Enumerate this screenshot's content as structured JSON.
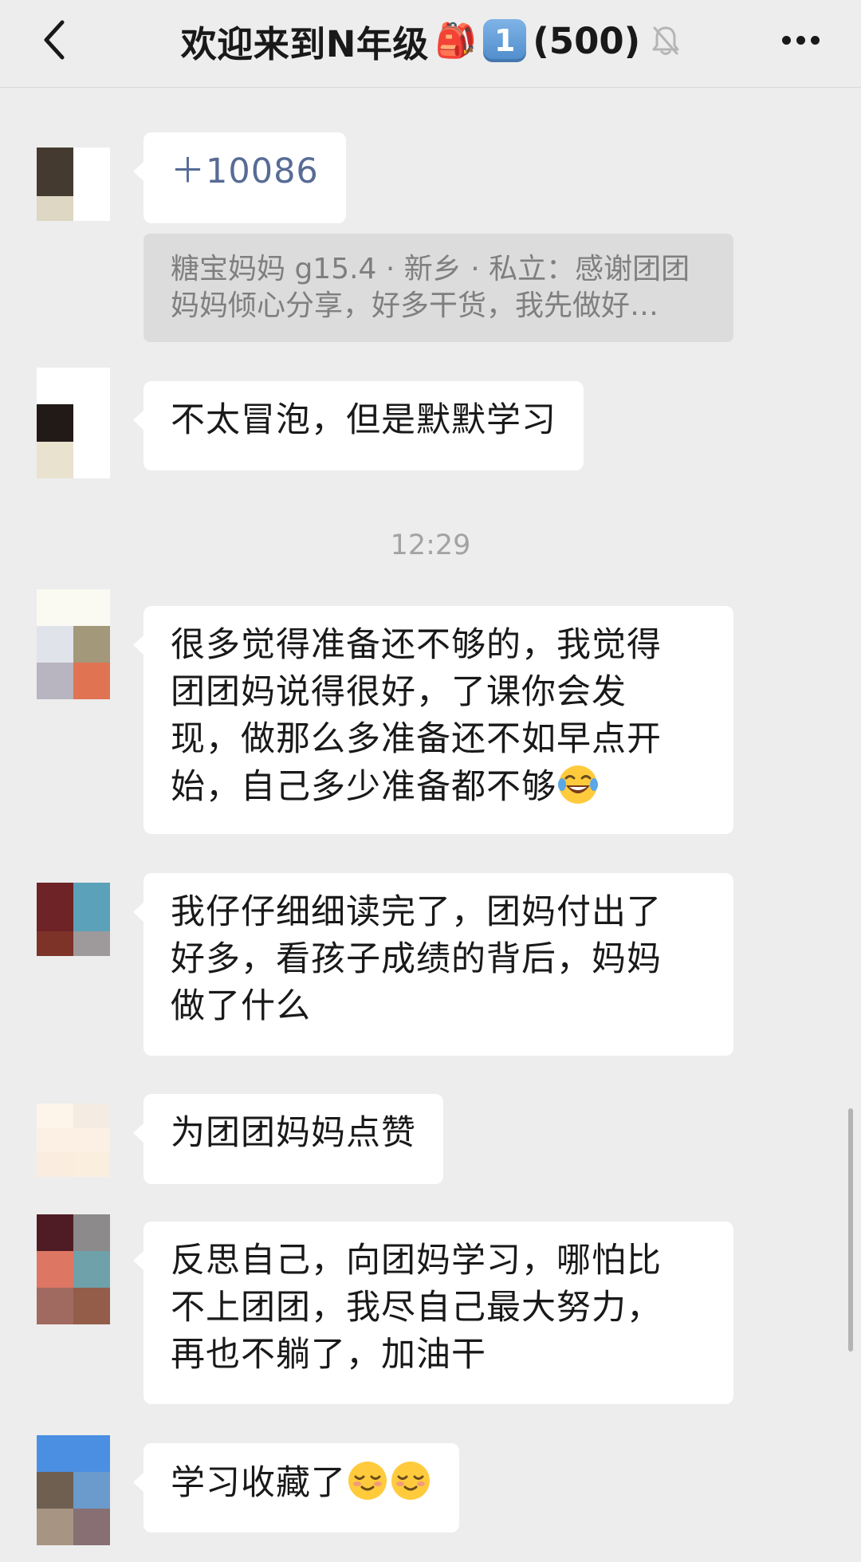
{
  "header": {
    "title": "欢迎来到N年级",
    "backpack_emoji": "🎒",
    "keycap": "1",
    "member_count": "(500)",
    "back_icon": "chevron-left-icon",
    "mute_icon": "bell-off-icon",
    "more_icon": "more-dots-icon"
  },
  "messages": [
    {
      "text": "＋10086",
      "quote": {
        "line1": "糖宝妈妈 g15.4 · 新乡 · 私立：感谢团团",
        "line2": "妈妈倾心分享，好多干货，我先做好…"
      }
    },
    {
      "text": "不太冒泡，但是默默学习"
    },
    {
      "lines": [
        "很多觉得准备还不够的，我觉得",
        "团团妈说得很好，了课你会发",
        "现，做那么多准备还不如早点开",
        "始，自己多少准备都不够"
      ],
      "emoji": "laughing-tears-emoji"
    },
    {
      "lines": [
        "我仔仔细细读完了，团妈付出了",
        "好多，看孩子成绩的背后，妈妈",
        "做了什么"
      ]
    },
    {
      "text": "为团团妈妈点赞"
    },
    {
      "lines": [
        "反思自己，向团妈学习，哪怕比",
        "不上团团，我尽自己最大努力，",
        "再也不躺了，加油干"
      ]
    },
    {
      "text": "学习收藏了",
      "emoji": "blushing-smile-emoji"
    }
  ],
  "timestamp": "12:29",
  "colors": {
    "background": "#ededed",
    "bubble": "#ffffff",
    "link": "#576b95",
    "quote_bg": "#dcdcdc",
    "timestamp": "#a3a3a3"
  }
}
